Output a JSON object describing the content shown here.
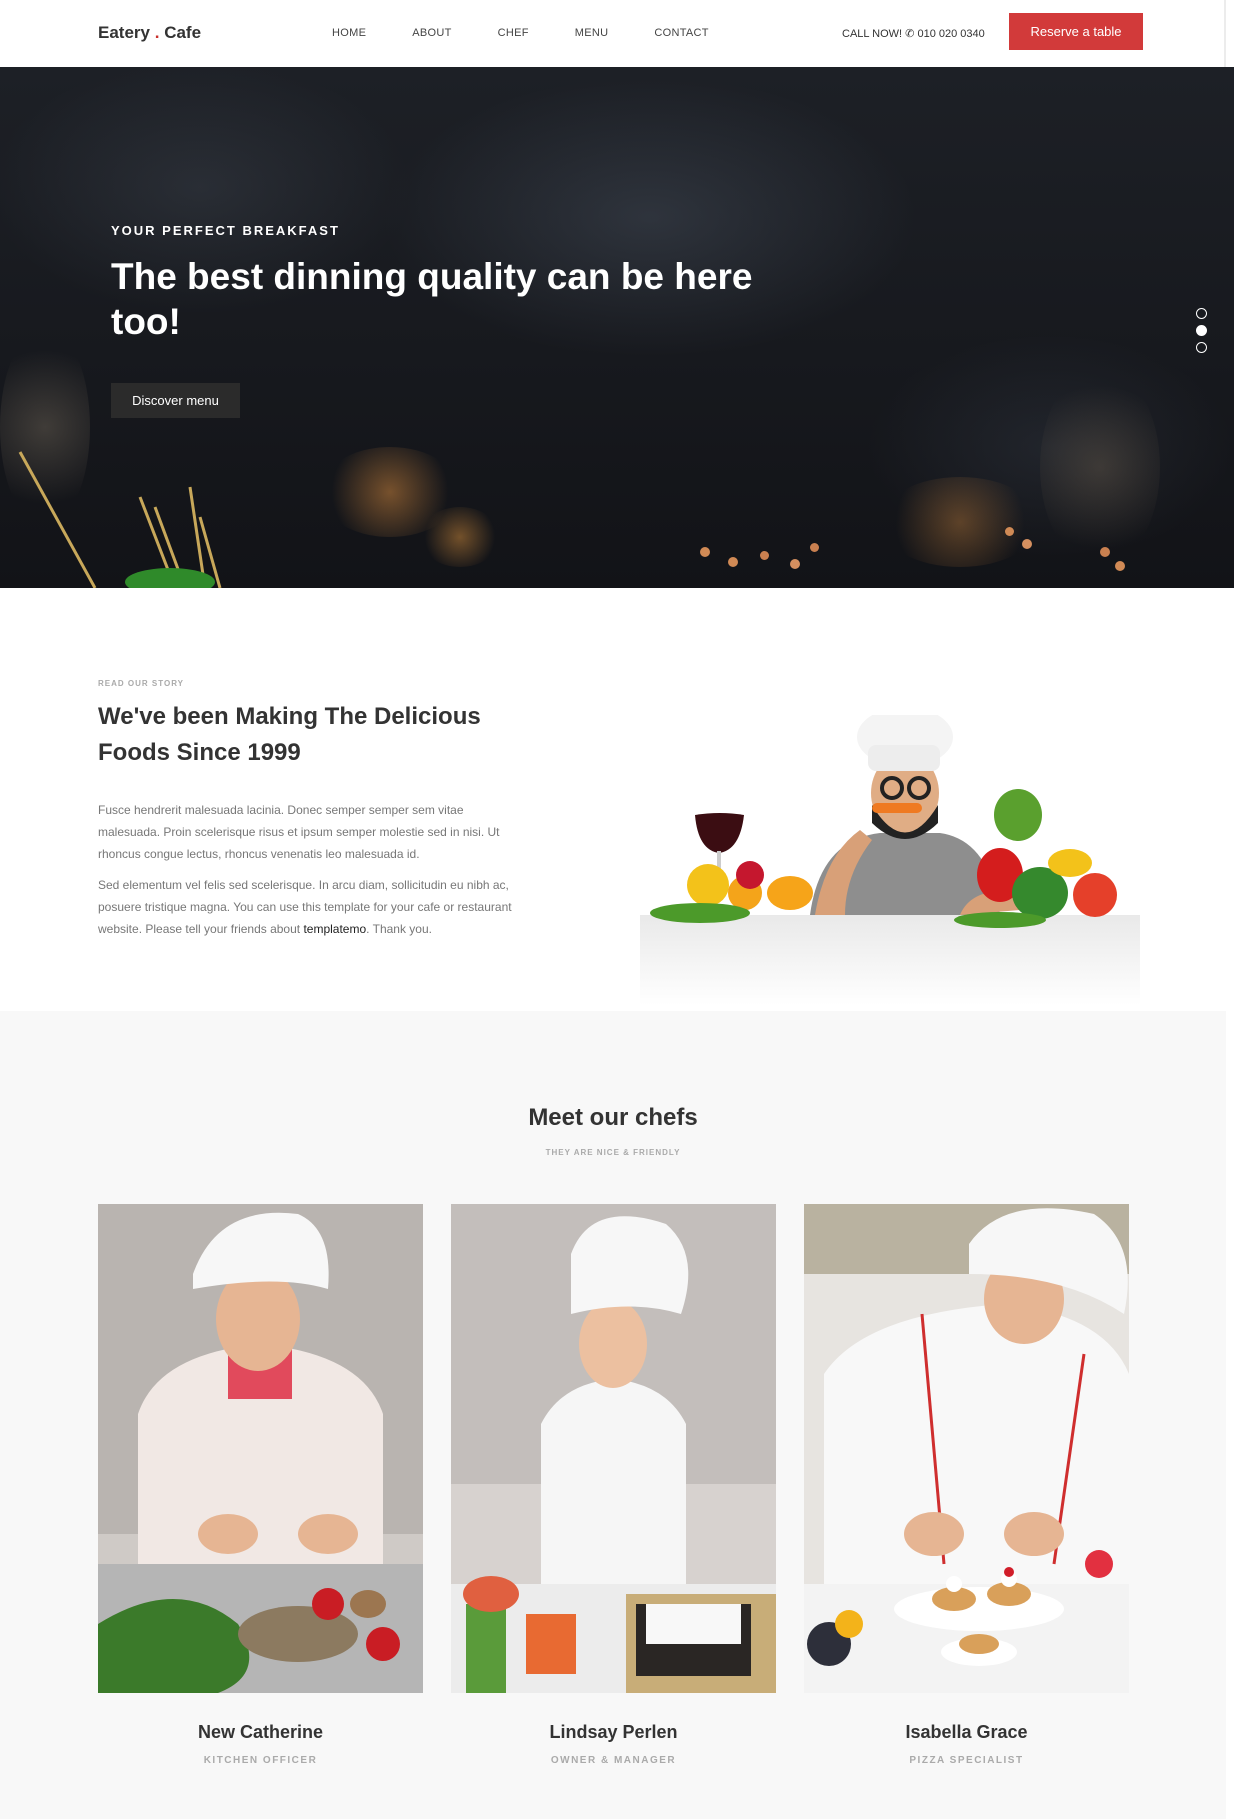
{
  "navbar": {
    "brand_name": "Eatery",
    "brand_dot": ".",
    "brand_suffix": "Cafe",
    "menu": [
      {
        "label": "HOME"
      },
      {
        "label": "ABOUT"
      },
      {
        "label": "CHEF"
      },
      {
        "label": "MENU"
      },
      {
        "label": "CONTACT"
      }
    ],
    "call_label": "CALL NOW!",
    "phone": "010 020 0340",
    "reserve_label": "Reserve a table",
    "accent_color": "#d23a3a"
  },
  "hero": {
    "subtitle": "YOUR PERFECT BREAKFAST",
    "title": "The best dinning quality can be here too!",
    "button_label": "Discover menu",
    "slide_count": 3,
    "active_slide": 2
  },
  "story": {
    "label": "READ OUR STORY",
    "title": "We've been Making The Delicious Foods Since 1999",
    "paragraph1": "Fusce hendrerit malesuada lacinia. Donec semper semper sem vitae malesuada. Proin scelerisque risus et ipsum semper molestie sed in nisi. Ut rhoncus congue lectus, rhoncus venenatis leo malesuada id.",
    "paragraph2_start": "Sed elementum vel felis sed scelerisque. In arcu diam, sollicitudin eu nibh ac, posuere tristique magna. You can use this template for your cafe or restaurant website. Please tell your friends about ",
    "paragraph2_link": "templatemo",
    "paragraph2_end": ". Thank you."
  },
  "chefs": {
    "title": "Meet our chefs",
    "subtitle": "THEY ARE NICE & FRIENDLY",
    "members": [
      {
        "name": "New Catherine",
        "role": "KITCHEN OFFICER"
      },
      {
        "name": "Lindsay Perlen",
        "role": "OWNER & MANAGER"
      },
      {
        "name": "Isabella Grace",
        "role": "PIZZA SPECIALIST"
      }
    ]
  }
}
